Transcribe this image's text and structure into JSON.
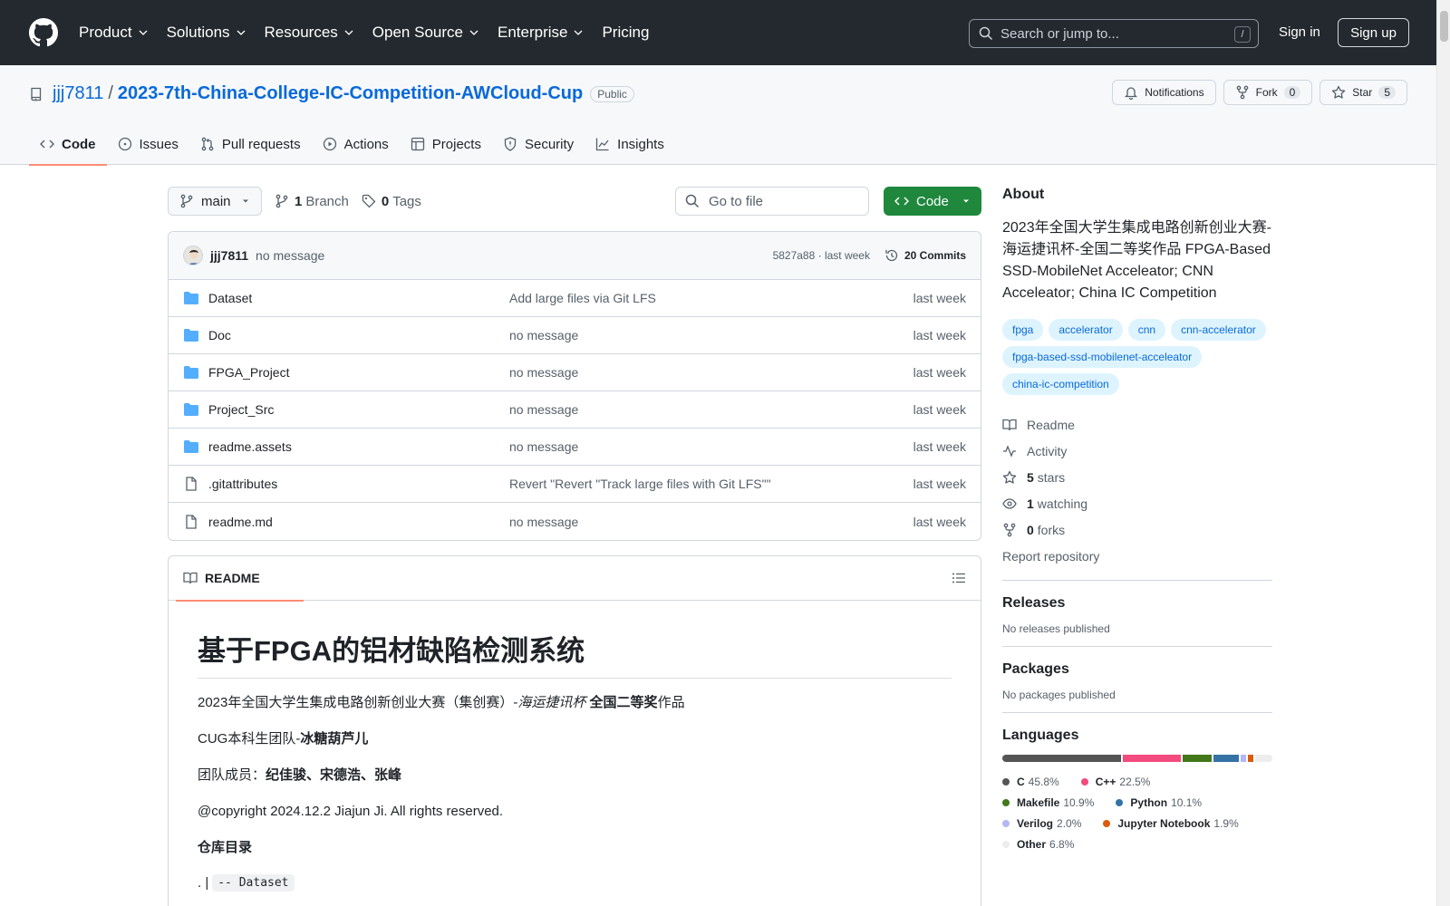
{
  "topnav": {
    "items": [
      "Product",
      "Solutions",
      "Resources",
      "Open Source",
      "Enterprise",
      "Pricing"
    ],
    "search_placeholder": "Search or jump to...",
    "slash": "/",
    "signin": "Sign in",
    "signup": "Sign up"
  },
  "repo": {
    "owner": "jjj7811",
    "sep": "/",
    "name": "2023-7th-China-College-IC-Competition-AWCloud-Cup",
    "visibility": "Public",
    "notifications": "Notifications",
    "fork_label": "Fork",
    "fork_count": "0",
    "star_label": "Star",
    "star_count": "5"
  },
  "tabs": [
    "Code",
    "Issues",
    "Pull requests",
    "Actions",
    "Projects",
    "Security",
    "Insights"
  ],
  "toolbar": {
    "branch": "main",
    "branch_count": "1",
    "branch_label": "Branch",
    "tag_count": "0",
    "tag_label": "Tags",
    "goto_placeholder": "Go to file",
    "code_label": "Code"
  },
  "commit": {
    "user": "jjj7811",
    "message": "no message",
    "meta": "5827a88 · last week",
    "commits": "20 Commits"
  },
  "files": [
    {
      "type": "folder",
      "name": "Dataset",
      "message": "Add large files via Git LFS",
      "time": "last week"
    },
    {
      "type": "folder",
      "name": "Doc",
      "message": "no message",
      "time": "last week"
    },
    {
      "type": "folder",
      "name": "FPGA_Project",
      "message": "no message",
      "time": "last week"
    },
    {
      "type": "folder",
      "name": "Project_Src",
      "message": "no message",
      "time": "last week"
    },
    {
      "type": "folder",
      "name": "readme.assets",
      "message": "no message",
      "time": "last week"
    },
    {
      "type": "file",
      "name": ".gitattributes",
      "message": "Revert \"Revert \"Track large files with Git LFS\"\"",
      "time": "last week"
    },
    {
      "type": "file",
      "name": "readme.md",
      "message": "no message",
      "time": "last week"
    }
  ],
  "readme": {
    "tab": "README",
    "title": "基于FPGA的铝材缺陷检测系统",
    "p1_a": "2023年全国大学生集成电路创新创业大赛（集创赛）-",
    "p1_i": "海运捷讯杯",
    "p1_b": " 全国二等奖",
    "p1_c": "作品",
    "p2_a": "CUG本科生团队-",
    "p2_b": "冰糖葫芦儿",
    "p3_a": "团队成员：",
    "p3_b": "纪佳骏、宋德浩、张峰",
    "p4": "@copyright 2024.12.2 Jiajun Ji. All rights reserved.",
    "p5": "仓库目录",
    "tree_dot": ". |",
    "tree_code": "-- Dataset"
  },
  "about": {
    "title": "About",
    "description": "2023年全国大学生集成电路创新创业大赛-海运捷讯杯-全国二等奖作品 FPGA-Based SSD-MobileNet Acceleator; CNN Acceleator; China IC Competition",
    "topics": [
      "fpga",
      "accelerator",
      "cnn",
      "cnn-accelerator",
      "fpga-based-ssd-mobilenet-acceleator",
      "china-ic-competition"
    ],
    "readme": "Readme",
    "activity": "Activity",
    "stars_count": "5",
    "stars_label": "stars",
    "watching_count": "1",
    "watching_label": "watching",
    "forks_count": "0",
    "forks_label": "forks",
    "report": "Report repository"
  },
  "releases": {
    "title": "Releases",
    "text": "No releases published"
  },
  "packages": {
    "title": "Packages",
    "text": "No packages published"
  },
  "languages": {
    "title": "Languages",
    "items": [
      {
        "name": "C",
        "pct": "45.8%",
        "value": 45.8,
        "color": "#555555"
      },
      {
        "name": "C++",
        "pct": "22.5%",
        "value": 22.5,
        "color": "#f34b7d"
      },
      {
        "name": "Makefile",
        "pct": "10.9%",
        "value": 10.9,
        "color": "#427819"
      },
      {
        "name": "Python",
        "pct": "10.1%",
        "value": 10.1,
        "color": "#3572a5"
      },
      {
        "name": "Verilog",
        "pct": "2.0%",
        "value": 2.0,
        "color": "#b2b7f8"
      },
      {
        "name": "Jupyter Notebook",
        "pct": "1.9%",
        "value": 1.9,
        "color": "#da5b0b"
      },
      {
        "name": "Other",
        "pct": "6.8%",
        "value": 6.8,
        "color": "#ededed"
      }
    ]
  }
}
